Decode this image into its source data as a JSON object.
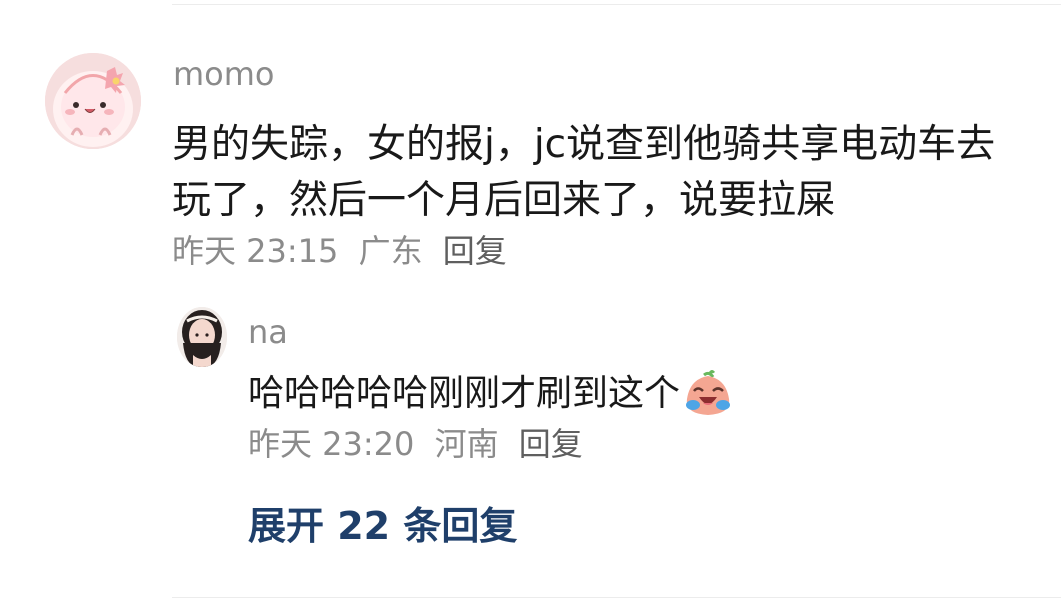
{
  "comment": {
    "avatar_icon": "cartoon-pink-avatar-icon",
    "username": "momo",
    "content": "男的失踪，女的报j，jc说查到他骑共享电动车去玩了，然后一个月后回来了，说要拉屎",
    "time": "昨天 23:15",
    "location": "广东",
    "reply_label": "回复"
  },
  "reply": {
    "avatar_icon": "girl-portrait-avatar-icon",
    "username": "na",
    "content": "哈哈哈哈哈刚刚才刷到这个",
    "emoji_icon": "laughing-crying-emoji-icon",
    "time": "昨天 23:20",
    "location": "河南",
    "reply_label": "回复"
  },
  "expand": {
    "label": "展开 22 条回复"
  },
  "colors": {
    "text_primary": "#191919",
    "text_secondary": "#8b8b8b",
    "link": "#1f3f6a"
  }
}
